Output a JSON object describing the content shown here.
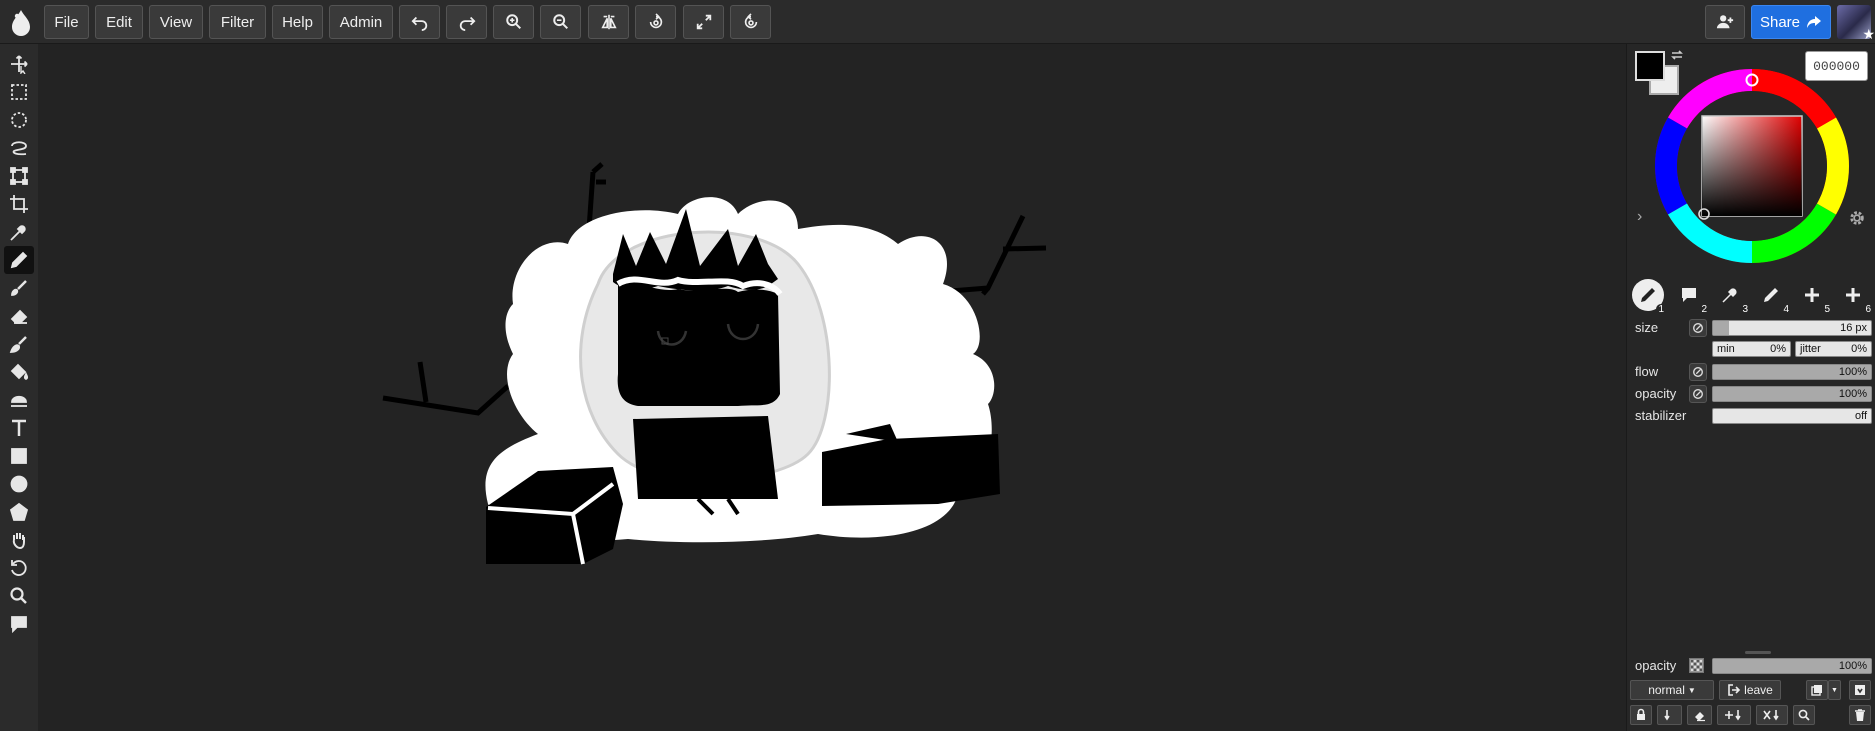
{
  "topbar": {
    "menus": [
      "File",
      "Edit",
      "View",
      "Filter",
      "Help",
      "Admin"
    ],
    "share_label": "Share"
  },
  "colors": {
    "primary": "#000000",
    "secondary": "#eeeeee",
    "accent": "#1f6fe0",
    "hex_value": "000000"
  },
  "tools": [
    "move-icon",
    "rect-select-icon",
    "ellipse-select-icon",
    "lasso-icon",
    "transform-icon",
    "crop-icon",
    "eyedropper-icon",
    "pen-icon",
    "brush-icon",
    "eraser-icon",
    "smudge-icon",
    "fill-bucket-icon",
    "gradient-icon",
    "text-icon",
    "rectangle-icon",
    "ellipse-icon",
    "shape-icon",
    "hand-icon",
    "rotate-icon",
    "zoom-icon",
    "comment-icon"
  ],
  "active_tool": "pen-icon",
  "brush_slots": [
    {
      "num": "1",
      "icon": "pen-icon"
    },
    {
      "num": "2",
      "icon": "chat-icon"
    },
    {
      "num": "3",
      "icon": "eyedropper-icon"
    },
    {
      "num": "4",
      "icon": "pen-icon"
    },
    {
      "num": "5",
      "icon": "plus-icon"
    },
    {
      "num": "6",
      "icon": "plus-icon"
    }
  ],
  "brush": {
    "size_label": "size",
    "size_value": "16 px",
    "size_fraction": 0.1,
    "min_label": "min",
    "min_value": "0%",
    "jitter_label": "jitter",
    "jitter_value": "0%",
    "flow_label": "flow",
    "flow_value": "100%",
    "opacity_label": "opacity",
    "opacity_value": "100%",
    "stabilizer_label": "stabilizer",
    "stabilizer_value": "off"
  },
  "layer": {
    "opacity_label": "opacity",
    "opacity_value": "100%",
    "blend_mode": "normal",
    "leave_label": "leave"
  }
}
